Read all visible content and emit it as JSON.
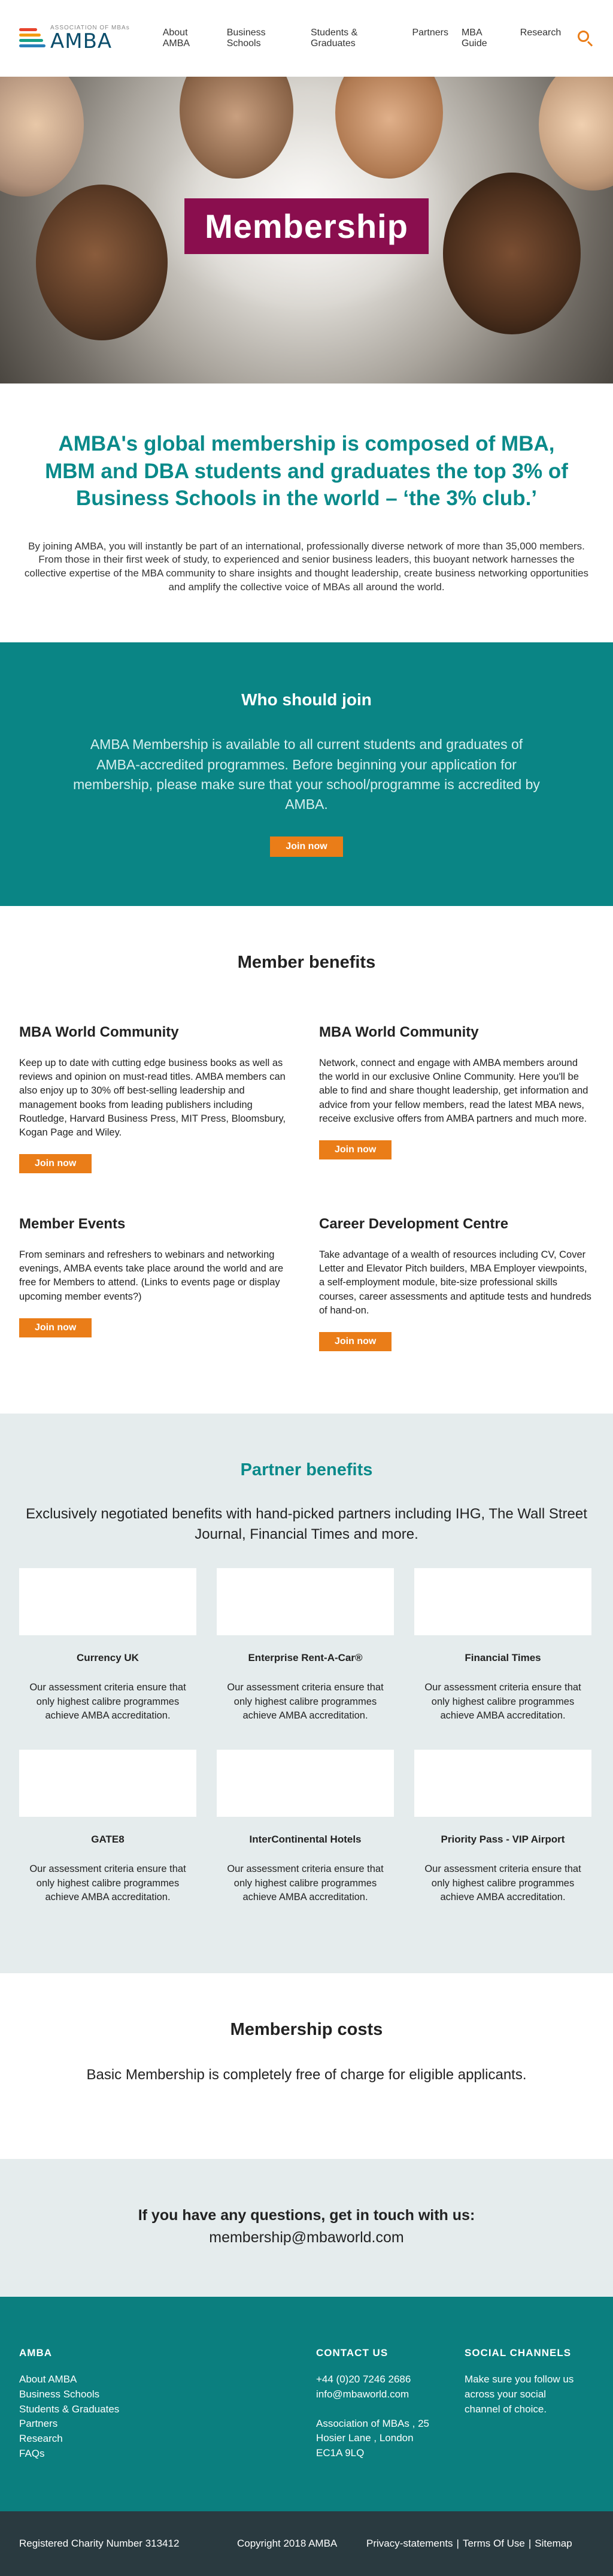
{
  "header": {
    "logo_small": "ASSOCIATION OF MBAs",
    "logo_big": "AMBA",
    "nav": [
      "About AMBA",
      "Business Schools",
      "Students & Graduates",
      "Partners",
      "MBA Guide",
      "Research"
    ],
    "colors": {
      "logo_bars": [
        "#e8432c",
        "#f39c12",
        "#16a085",
        "#2980b9"
      ],
      "accent": "#ea7d18"
    }
  },
  "hero": {
    "title": "Membership",
    "title_bg": "#8a0e4e"
  },
  "intro": {
    "heading": "AMBA's global membership is composed of MBA, MBM and DBA students and graduates the top 3% of Business Schools in the world – ‘the 3% club.’",
    "body": "By joining AMBA, you will instantly be part of an international, professionally diverse network of more than 35,000 members. From those in their first week of study, to experienced and senior business leaders, this buoyant network harnesses the collective expertise of the MBA community to share insights and thought leadership, create business networking opportunities and amplify the collective voice of MBAs all around the world."
  },
  "who": {
    "title": "Who should join",
    "body": "AMBA Membership is available to all current students and graduates of AMBA-accredited programmes. Before beginning your application for membership, please make sure that your school/programme is accredited by AMBA.",
    "button": "Join now"
  },
  "benefits": {
    "title": "Member benefits",
    "items": [
      {
        "title": "MBA World Community",
        "body": "Keep up to date with cutting edge business books as well as reviews and opinion on must-read titles. AMBA members can also enjoy up to 30% off best-selling leadership and management books from leading publishers including Routledge, Harvard Business Press, MIT Press, Bloomsbury, Kogan Page and Wiley.",
        "button": "Join now"
      },
      {
        "title": "MBA World Community",
        "body": "Network, connect and engage with AMBA members around the world in our exclusive Online Community. Here you'll be able to find and share thought leadership, get information and advice from your fellow members, read the latest MBA news, receive exclusive offers from AMBA partners and much more.",
        "button": "Join now"
      },
      {
        "title": "Member Events",
        "body": "From seminars and refreshers to webinars and networking evenings, AMBA events take place around the world and are free for Members to attend. (Links to events page or display upcoming member events?)",
        "button": "Join now"
      },
      {
        "title": "Career Development Centre",
        "body": "Take advantage of a wealth of resources including CV, Cover Letter and Elevator Pitch builders, MBA Employer viewpoints, a self-employment module, bite-size professional skills courses, career assessments and aptitude tests and hundreds of hand-on.",
        "button": "Join now"
      }
    ]
  },
  "partners": {
    "title": "Partner benefits",
    "subtitle": "Exclusively negotiated benefits with hand-picked partners including IHG, The Wall Street Journal, Financial Times and more.",
    "cards": [
      {
        "name": "Currency UK",
        "body": "Our assessment criteria ensure that only highest calibre programmes achieve AMBA accreditation."
      },
      {
        "name": "Enterprise Rent-A-Car®",
        "body": "Our assessment criteria ensure that only highest calibre programmes achieve AMBA accreditation."
      },
      {
        "name": "Financial Times",
        "body": "Our assessment criteria ensure that only highest calibre programmes achieve AMBA accreditation."
      },
      {
        "name": "GATE8",
        "body": "Our assessment criteria ensure that only highest calibre programmes achieve AMBA accreditation."
      },
      {
        "name": "InterContinental Hotels",
        "body": "Our assessment criteria ensure that only highest calibre programmes achieve AMBA accreditation."
      },
      {
        "name": "Priority Pass - VIP Airport",
        "body": "Our assessment criteria ensure that only highest calibre programmes achieve AMBA accreditation."
      }
    ]
  },
  "costs": {
    "title": "Membership costs",
    "body": "Basic Membership is completely free of charge for eligible applicants."
  },
  "questions": {
    "title": "If you have any questions, get in touch with us:",
    "email": "membership@mbaworld.com"
  },
  "footer": {
    "col1_title": "AMBA",
    "col1_links": [
      "About AMBA",
      "Business Schools",
      "Students & Graduates",
      "Partners",
      "Research",
      "FAQs"
    ],
    "col2_title": "CONTACT US",
    "col2_lines": [
      "+44 (0)20 7246 2686",
      "info@mbaworld.com",
      "",
      "Association of MBAs , 25",
      "Hosier Lane , London",
      "EC1A 9LQ"
    ],
    "col3_title": "SOCIAL CHANNELS",
    "col3_body": "Make sure you follow us across your social channel of choice."
  },
  "bottom": {
    "registered": "Registered Charity Number 313412",
    "copyright": "Copyright 2018 AMBA",
    "links": [
      "Privacy-statements",
      "Terms Of Use",
      "Sitemap"
    ],
    "separator": "|"
  }
}
